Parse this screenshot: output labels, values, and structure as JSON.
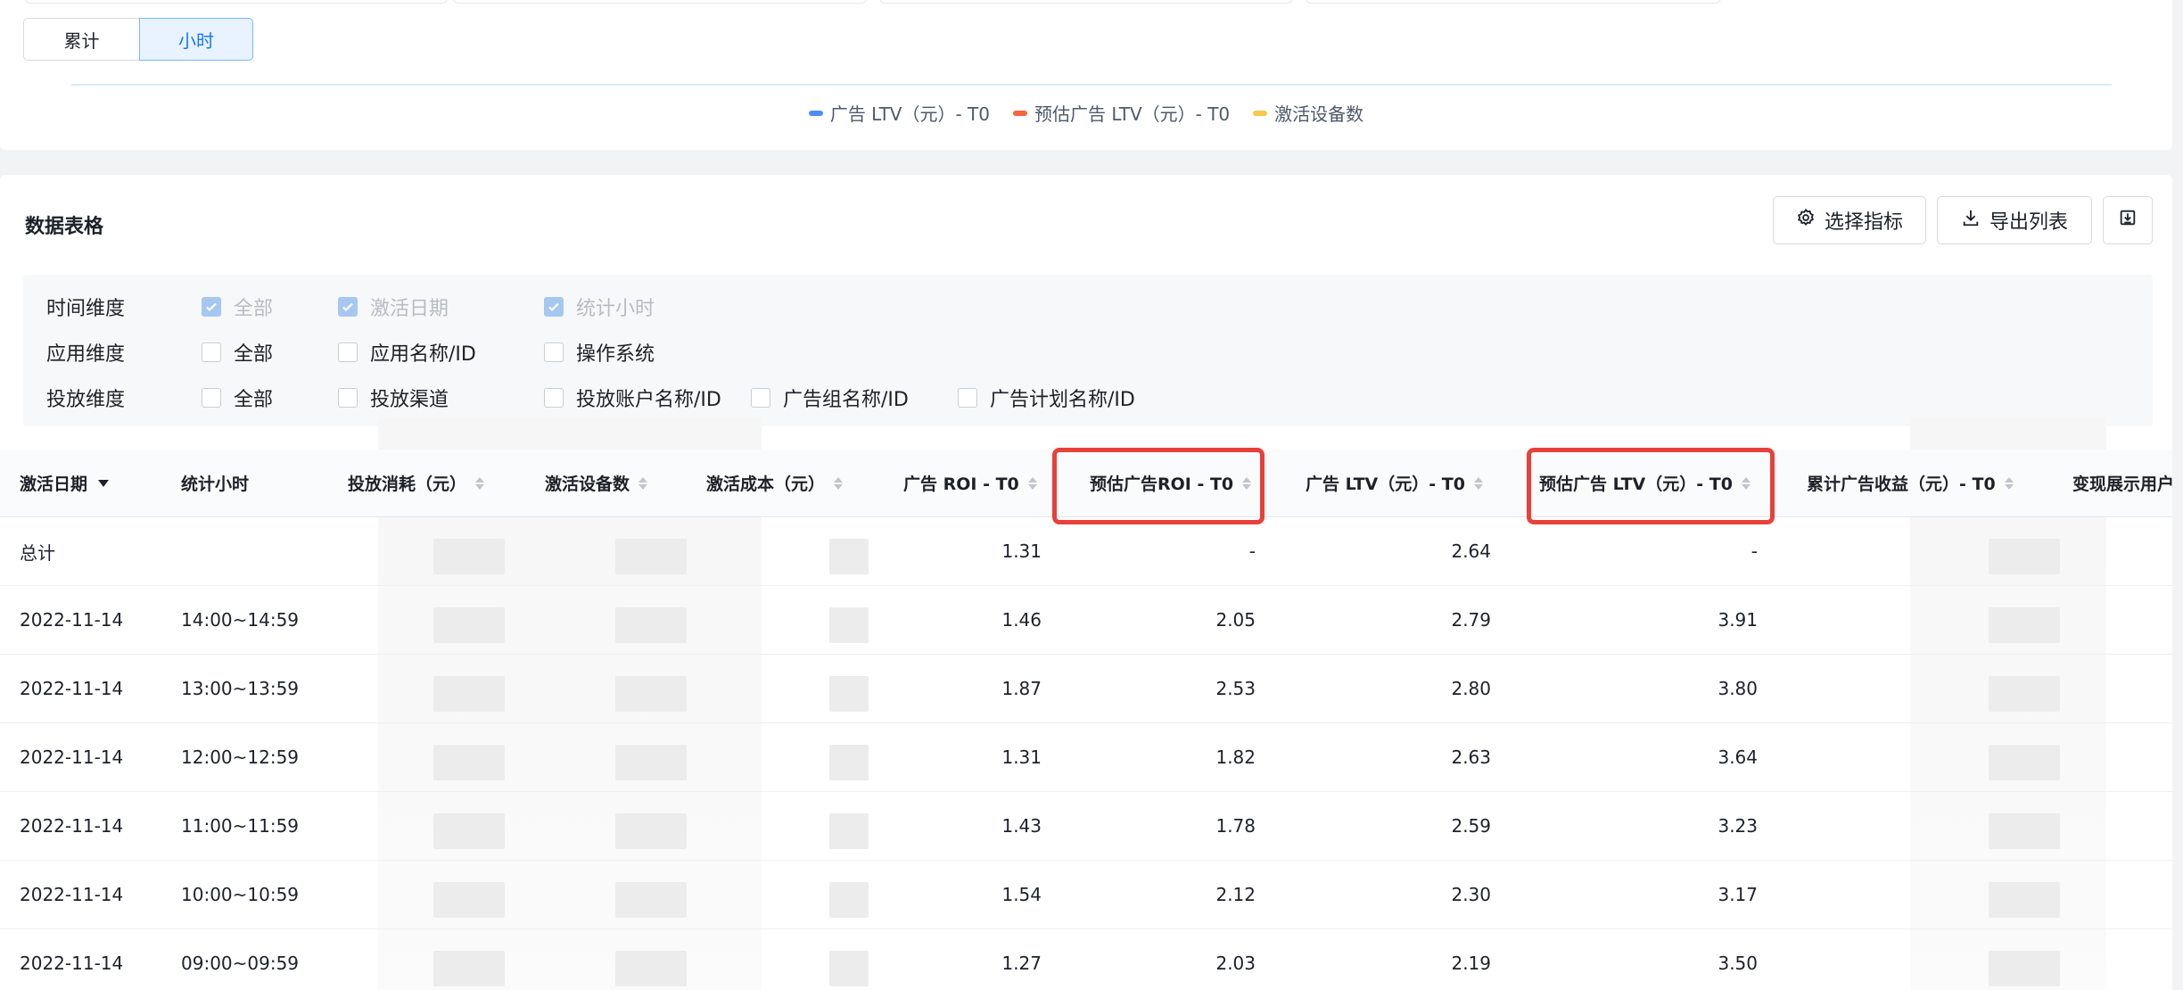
{
  "toggle": {
    "cumulative": "累计",
    "hourly": "小时",
    "selected": "hourly"
  },
  "legend": [
    {
      "label": "广告 LTV（元）- T0",
      "color": "#4e8cf5"
    },
    {
      "label": "预估广告 LTV（元）- T0",
      "color": "#f4663c"
    },
    {
      "label": "激活设备数",
      "color": "#f7c84a"
    }
  ],
  "table_card": {
    "title": "数据表格",
    "select_metrics": "选择指标",
    "export_list": "导出列表"
  },
  "filters": {
    "rows": [
      {
        "label": "时间维度",
        "options": [
          {
            "text": "全部",
            "checked": true,
            "disabled": true
          },
          {
            "text": "激活日期",
            "checked": true,
            "disabled": true
          },
          {
            "text": "统计小时",
            "checked": true,
            "disabled": true
          }
        ]
      },
      {
        "label": "应用维度",
        "options": [
          {
            "text": "全部",
            "checked": false
          },
          {
            "text": "应用名称/ID",
            "checked": false
          },
          {
            "text": "操作系统",
            "checked": false
          }
        ]
      },
      {
        "label": "投放维度",
        "options": [
          {
            "text": "全部",
            "checked": false
          },
          {
            "text": "投放渠道",
            "checked": false
          },
          {
            "text": "投放账户名称/ID",
            "checked": false
          },
          {
            "text": "广告组名称/ID",
            "checked": false
          },
          {
            "text": "广告计划名称/ID",
            "checked": false
          }
        ]
      }
    ]
  },
  "table": {
    "columns": [
      "激活日期",
      "统计小时",
      "投放消耗（元）",
      "激活设备数",
      "激活成本（元）",
      "广告 ROI - T0",
      "预估广告ROI - T0",
      "广告 LTV（元）- T0",
      "预估广告 LTV（元）- T0",
      "累计广告收益（元）- T0",
      "变现展示用户"
    ],
    "rows": [
      {
        "date": "总计",
        "hour": "",
        "roi": "1.31",
        "est_roi": "-",
        "ltv": "2.64",
        "est_ltv": "-"
      },
      {
        "date": "2022-11-14",
        "hour": "14:00~14:59",
        "roi": "1.46",
        "est_roi": "2.05",
        "ltv": "2.79",
        "est_ltv": "3.91"
      },
      {
        "date": "2022-11-14",
        "hour": "13:00~13:59",
        "roi": "1.87",
        "est_roi": "2.53",
        "ltv": "2.80",
        "est_ltv": "3.80"
      },
      {
        "date": "2022-11-14",
        "hour": "12:00~12:59",
        "roi": "1.31",
        "est_roi": "1.82",
        "ltv": "2.63",
        "est_ltv": "3.64"
      },
      {
        "date": "2022-11-14",
        "hour": "11:00~11:59",
        "roi": "1.43",
        "est_roi": "1.78",
        "ltv": "2.59",
        "est_ltv": "3.23"
      },
      {
        "date": "2022-11-14",
        "hour": "10:00~10:59",
        "roi": "1.54",
        "est_roi": "2.12",
        "ltv": "2.30",
        "est_ltv": "3.17"
      },
      {
        "date": "2022-11-14",
        "hour": "09:00~09:59",
        "roi": "1.27",
        "est_roi": "2.03",
        "ltv": "2.19",
        "est_ltv": "3.50"
      }
    ]
  },
  "highlight_color": "#e8403a"
}
